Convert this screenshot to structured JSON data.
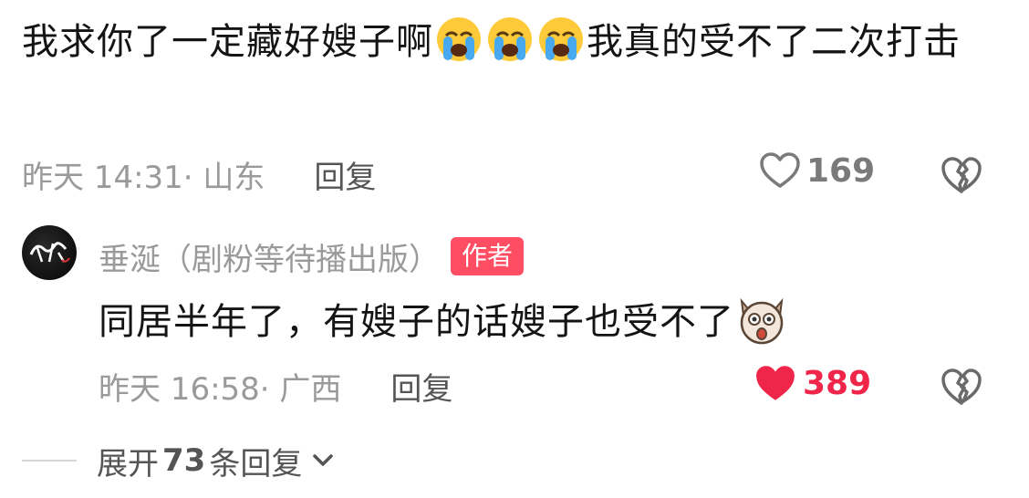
{
  "comment": {
    "text_before_emoji": "我求你了一定藏好嫂子啊",
    "emoji": "crying-face",
    "text_after_emoji": "我真的受不了二次打击",
    "time": "昨天 14:31· 山东",
    "reply_label": "回复",
    "likes": "169",
    "liked": false
  },
  "reply": {
    "author": "垂涎（剧粉等待播出版）",
    "badge": "作者",
    "text": "同居半年了，有嫂子的话嫂子也受不了",
    "emoji": "shocked-dog",
    "time": "昨天 16:58· 广西",
    "reply_label": "回复",
    "likes": "389",
    "liked": true
  },
  "expand": {
    "prefix": "展开",
    "count": "73",
    "suffix": "条回复"
  },
  "colors": {
    "like_active": "#f0254a",
    "like_inactive": "#7a7a7a",
    "badge_bg": "#ff4d63"
  }
}
